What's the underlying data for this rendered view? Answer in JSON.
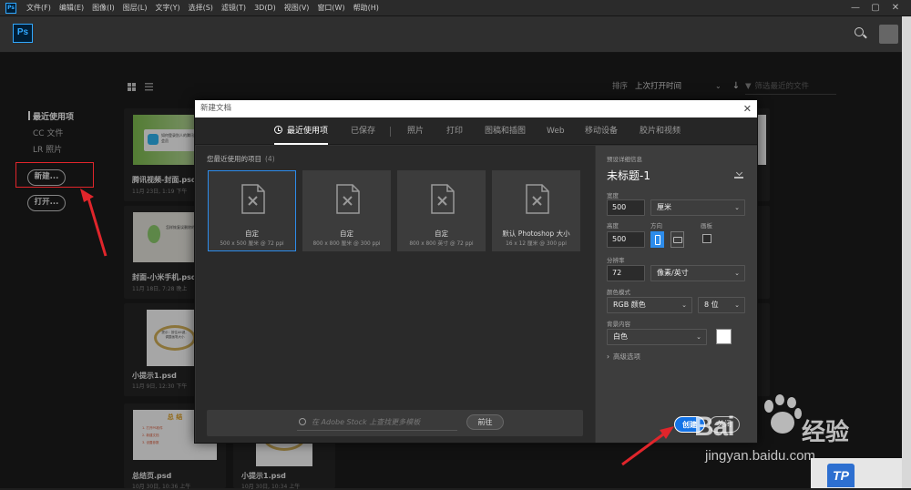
{
  "menubar": {
    "logo": "Ps",
    "items": [
      "文件(F)",
      "编辑(E)",
      "图像(I)",
      "图层(L)",
      "文字(Y)",
      "选择(S)",
      "滤镜(T)",
      "3D(D)",
      "视图(V)",
      "窗口(W)",
      "帮助(H)"
    ],
    "window_min": "—",
    "window_max": "▢",
    "window_close": "✕"
  },
  "appbar": {
    "logo": "Ps"
  },
  "home": {
    "nav": [
      "最近使用项",
      "CC 文件",
      "LR 照片"
    ],
    "new_button": "新建...",
    "open_button": "打开...",
    "sort_label": "排序",
    "sort_value": "上次打开时间",
    "filter_placeholder": "筛选最近的文件",
    "files": [
      {
        "name": "腾讯视频-封面.psd",
        "date": "11月 23日, 1:19 下午"
      },
      {
        "name": "封面-小米手机.psd",
        "date": "11月 18日, 7:28 晚上"
      },
      {
        "name": "小提示1.psd",
        "date": "11月 9日, 12:30 下午"
      },
      {
        "name": "总结页.psd",
        "date": "10月 30日, 10:36 上午"
      },
      {
        "name": "小提示1.psd",
        "date": "10月 30日, 10:34 上午"
      }
    ],
    "thumb_texts": {
      "tencent": "如何登录别人的腾讯视频会员",
      "xiaomi": "怎样恢复误删除的联系人",
      "tip": "提示：按住Alt键，调整画笔大小",
      "summary_title": "总 结",
      "summary_lines": [
        "1. 打开PS软件",
        "2. 新建文档",
        "3. 设置参数"
      ]
    }
  },
  "dialog": {
    "title": "新建文档",
    "close": "✕",
    "tabs": [
      "最近使用项",
      "已保存",
      "照片",
      "打印",
      "图稿和插图",
      "Web",
      "移动设备",
      "胶片和视频"
    ],
    "recent_label": "您最近使用的项目",
    "recent_count": "(4)",
    "presets": [
      {
        "name": "自定",
        "desc": "500 x 500 厘米 @ 72 ppi"
      },
      {
        "name": "自定",
        "desc": "800 x 800 厘米 @ 300 ppi"
      },
      {
        "name": "自定",
        "desc": "800 x 800 英寸 @ 72 ppi"
      },
      {
        "name": "默认 Photoshop 大小",
        "desc": "16 x 12 厘米 @ 300 ppi"
      }
    ],
    "stock_placeholder": "在 Adobe Stock 上查找更多模板",
    "go_button": "前往",
    "details": {
      "header": "预设详细信息",
      "doc_name": "未标题-1",
      "width_label": "宽度",
      "width_value": "500",
      "width_unit": "厘米",
      "height_label": "高度",
      "height_value": "500",
      "orientation_label": "方向",
      "artboard_label": "画板",
      "resolution_label": "分辨率",
      "resolution_value": "72",
      "resolution_unit": "像素/英寸",
      "color_mode_label": "颜色模式",
      "color_mode_value": "RGB 颜色",
      "bit_depth": "8 位",
      "background_label": "背景内容",
      "background_value": "白色",
      "advanced": "高级选项",
      "create_button": "创建",
      "close_button": "关闭"
    }
  },
  "watermark": {
    "bai": "Bai",
    "du": "经验",
    "url": "jingyan.baidu.com"
  },
  "corner_logo": "TP",
  "colors": {
    "accent": "#1473e6",
    "annotation": "#e0252b"
  }
}
